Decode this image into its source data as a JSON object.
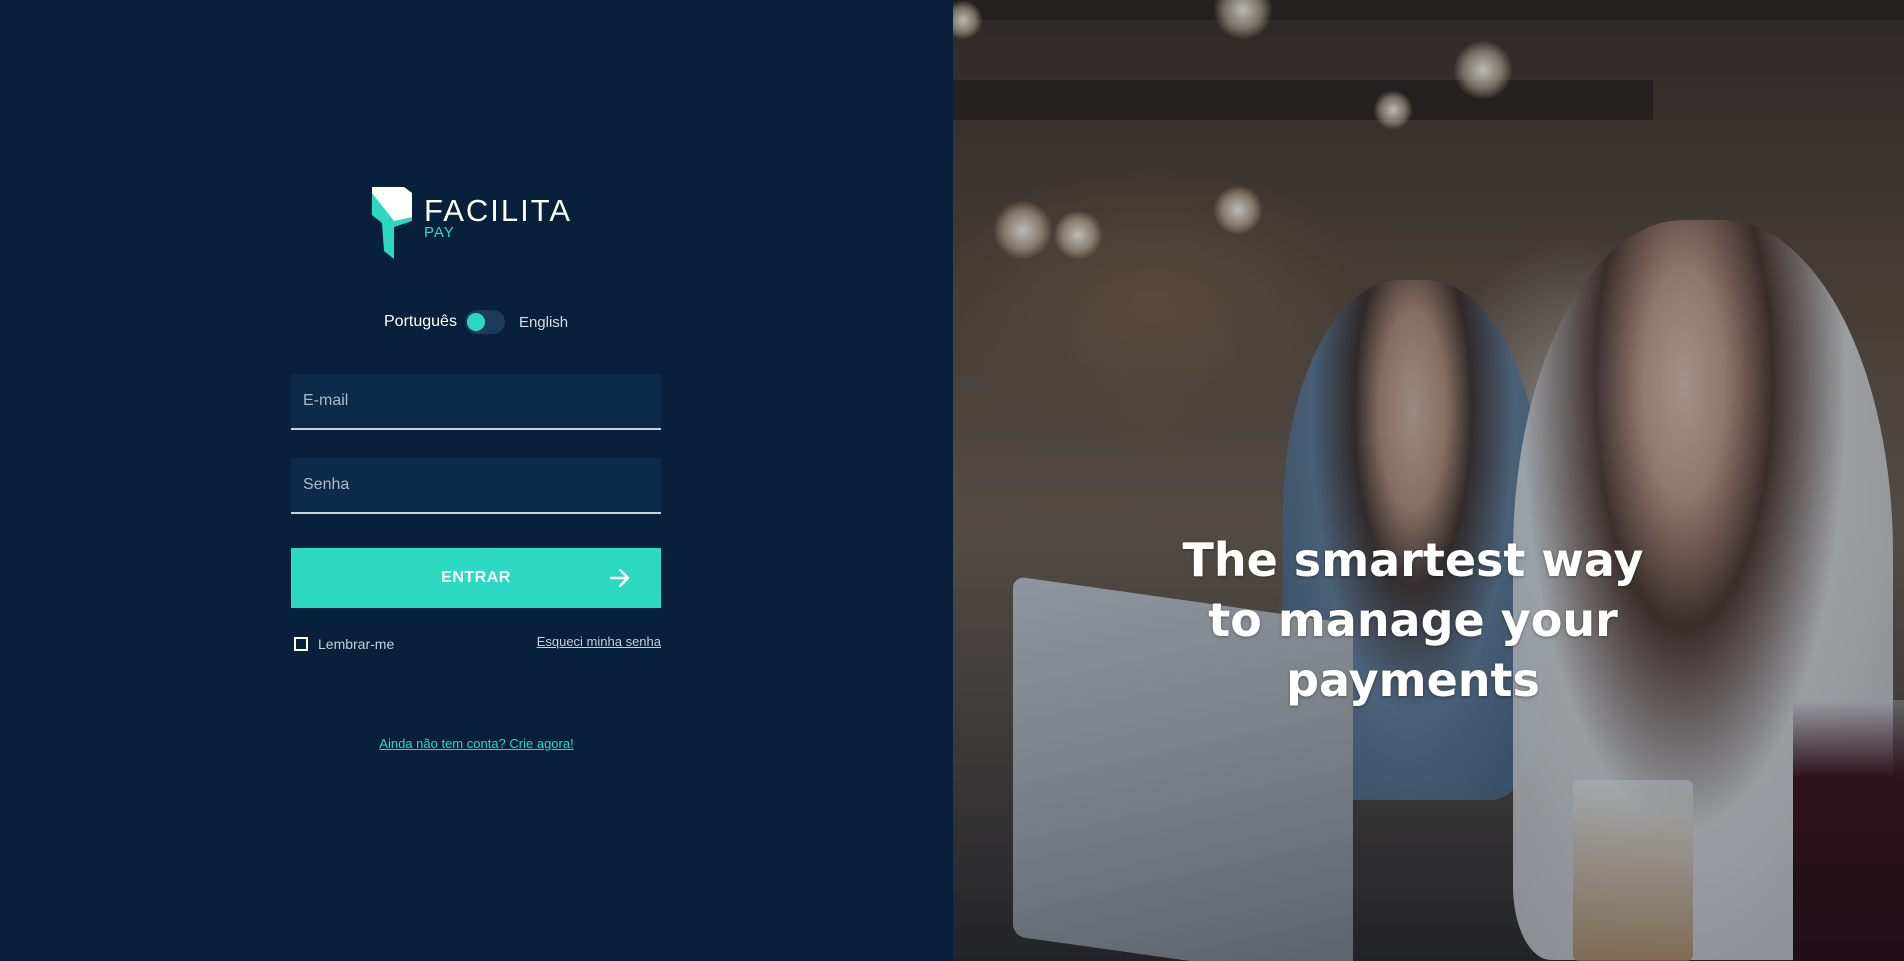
{
  "brand": {
    "name": "FACILITA",
    "sub": "PAY",
    "colors": {
      "background": "#08203b",
      "accent": "#2bd9c0",
      "input_background": "#0c2b4a"
    }
  },
  "language": {
    "primary_label": "Português",
    "secondary_label": "English",
    "selected": "Português"
  },
  "form": {
    "email_placeholder": "E-mail",
    "password_placeholder": "Senha",
    "submit_label": "ENTRAR",
    "remember_label": "Lembrar-me",
    "forgot_label": "Esqueci minha senha",
    "signup_label": "Ainda não tem conta? Crie agora!"
  },
  "hero": {
    "headline": "The smartest way to manage your payments"
  },
  "icons": {
    "logo": "facilita-pay-logo-mark",
    "submit": "arrow-right-icon"
  }
}
